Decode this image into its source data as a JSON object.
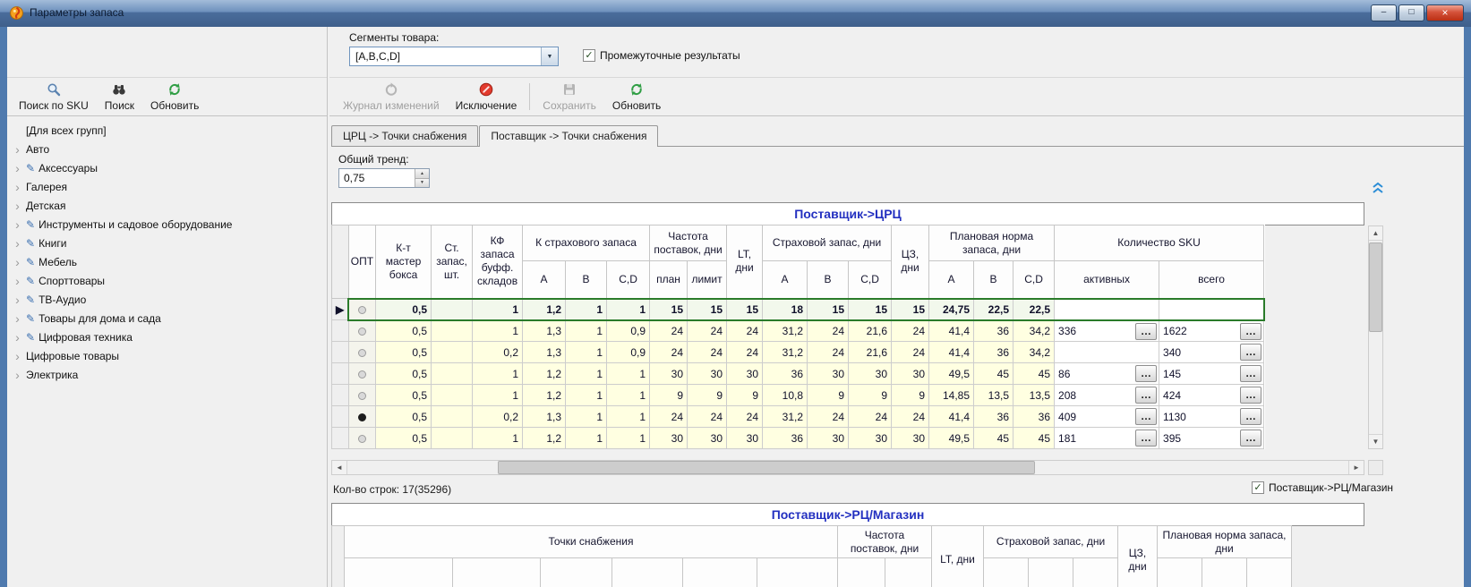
{
  "window": {
    "title": "Параметры запаса",
    "minimize": "–",
    "maximize": "□",
    "close": "×"
  },
  "glyphs": {
    "combo_arrow": "▼",
    "spinner_up": "▲",
    "spinner_down": "▼",
    "check": "✓",
    "ellipsis": "…",
    "edit_pencil": "✎",
    "tree_expander": "›",
    "row_arrow": "▶",
    "scroll_left": "◄",
    "scroll_right": "►",
    "scroll_up": "▲",
    "scroll_down": "▼"
  },
  "left_panel": {
    "toolbar": [
      {
        "label": "Поиск по SKU",
        "icon": "search-icon"
      },
      {
        "label": "Поиск",
        "icon": "binoculars-icon"
      },
      {
        "label": "Обновить",
        "icon": "refresh-icon"
      }
    ],
    "tree_items": [
      {
        "label": "[Для всех групп]",
        "expander": false,
        "edit": false
      },
      {
        "label": "Авто",
        "expander": true,
        "edit": false
      },
      {
        "label": "Аксессуары",
        "expander": true,
        "edit": true
      },
      {
        "label": "Галерея",
        "expander": true,
        "edit": false
      },
      {
        "label": "Детская",
        "expander": true,
        "edit": false
      },
      {
        "label": "Инструменты и садовое оборудование",
        "expander": true,
        "edit": true
      },
      {
        "label": "Книги",
        "expander": true,
        "edit": true
      },
      {
        "label": "Мебель",
        "expander": true,
        "edit": true
      },
      {
        "label": "Спорттовары",
        "expander": true,
        "edit": true
      },
      {
        "label": "ТВ-Аудио",
        "expander": true,
        "edit": true
      },
      {
        "label": "Товары для дома и сада",
        "expander": true,
        "edit": true
      },
      {
        "label": "Цифровая техника",
        "expander": true,
        "edit": true
      },
      {
        "label": "Цифровые товары",
        "expander": true,
        "edit": false
      },
      {
        "label": "Электрика",
        "expander": true,
        "edit": false
      }
    ]
  },
  "segments": {
    "label": "Сегменты товара:",
    "value": "[A,B,C,D]",
    "checkbox_label": "Промежуточные результаты",
    "checkbox_checked": true
  },
  "main_toolbar": [
    {
      "label": "Журнал изменений",
      "icon": "history-icon",
      "disabled": true
    },
    {
      "label": "Исключение",
      "icon": "no-entry-icon",
      "disabled": false
    },
    {
      "label": "Сохранить",
      "icon": "save-icon",
      "disabled": true
    },
    {
      "label": "Обновить",
      "icon": "refresh-icon",
      "disabled": false
    }
  ],
  "tabs": [
    {
      "label": "ЦРЦ -> Точки снабжения",
      "active": false
    },
    {
      "label": "Поставщик -> Точки снабжения",
      "active": true
    }
  ],
  "trend": {
    "label": "Общий тренд:",
    "value": "0,75"
  },
  "grid1": {
    "title": "Поставщик->ЦРЦ",
    "headers": {
      "opt": "ОПТ",
      "k_master": "К-т мастер бокса",
      "st_zapas": "Ст. запас, шт.",
      "kf_zapasa": "КФ запаса буфф. складов",
      "k_strah": "К страхового запаса",
      "chastota": "Частота поставок, дни",
      "plan": "план",
      "limit": "лимит",
      "lt": "LT, дни",
      "strah_zapas": "Страховой запас, дни",
      "cz": "ЦЗ, дни",
      "plan_norma": "Плановая норма запаса, дни",
      "col_a": "A",
      "col_b": "B",
      "col_cd": "C,D",
      "sku": "Количество SKU",
      "sku_active": "активных",
      "sku_total": "всего"
    },
    "rows": [
      {
        "selected": true,
        "opt": false,
        "values": [
          "0,5",
          "",
          "1",
          "1,2",
          "1",
          "1",
          "15",
          "15",
          "15",
          "18",
          "15",
          "15",
          "15",
          "24,75",
          "22,5",
          "22,5"
        ],
        "sku_active": "",
        "sku_total": ""
      },
      {
        "selected": false,
        "opt": false,
        "values": [
          "0,5",
          "",
          "1",
          "1,3",
          "1",
          "0,9",
          "24",
          "24",
          "24",
          "31,2",
          "24",
          "21,6",
          "24",
          "41,4",
          "36",
          "34,2"
        ],
        "sku_active": "336",
        "sku_total": "1622"
      },
      {
        "selected": false,
        "opt": false,
        "values": [
          "0,5",
          "",
          "0,2",
          "1,3",
          "1",
          "0,9",
          "24",
          "24",
          "24",
          "31,2",
          "24",
          "21,6",
          "24",
          "41,4",
          "36",
          "34,2"
        ],
        "sku_active": "",
        "sku_total": "340"
      },
      {
        "selected": false,
        "opt": false,
        "values": [
          "0,5",
          "",
          "1",
          "1,2",
          "1",
          "1",
          "30",
          "30",
          "30",
          "36",
          "30",
          "30",
          "30",
          "49,5",
          "45",
          "45"
        ],
        "sku_active": "86",
        "sku_total": "145"
      },
      {
        "selected": false,
        "opt": false,
        "values": [
          "0,5",
          "",
          "1",
          "1,2",
          "1",
          "1",
          "9",
          "9",
          "9",
          "10,8",
          "9",
          "9",
          "9",
          "14,85",
          "13,5",
          "13,5"
        ],
        "sku_active": "208",
        "sku_total": "424"
      },
      {
        "selected": false,
        "opt": true,
        "values": [
          "0,5",
          "",
          "0,2",
          "1,3",
          "1",
          "1",
          "24",
          "24",
          "24",
          "31,2",
          "24",
          "24",
          "24",
          "41,4",
          "36",
          "36"
        ],
        "sku_active": "409",
        "sku_total": "1130"
      },
      {
        "selected": false,
        "opt": false,
        "values": [
          "0,5",
          "",
          "1",
          "1,2",
          "1",
          "1",
          "30",
          "30",
          "30",
          "36",
          "30",
          "30",
          "30",
          "49,5",
          "45",
          "45"
        ],
        "sku_active": "181",
        "sku_total": "395"
      }
    ]
  },
  "status": {
    "row_count": "Кол-во строк: 17(35296)"
  },
  "rc_checkbox": {
    "label": "Поставщик->РЦ/Магазин",
    "checked": true
  },
  "grid2": {
    "title": "Поставщик->РЦ/Магазин",
    "headers": {
      "points": "Точки снабжения",
      "chastota": "Частота поставок, дни",
      "lt": "LT, дни",
      "strah": "Страховой запас, дни",
      "cz": "ЦЗ, дни",
      "plan_norma": "Плановая норма запаса, дни"
    }
  }
}
